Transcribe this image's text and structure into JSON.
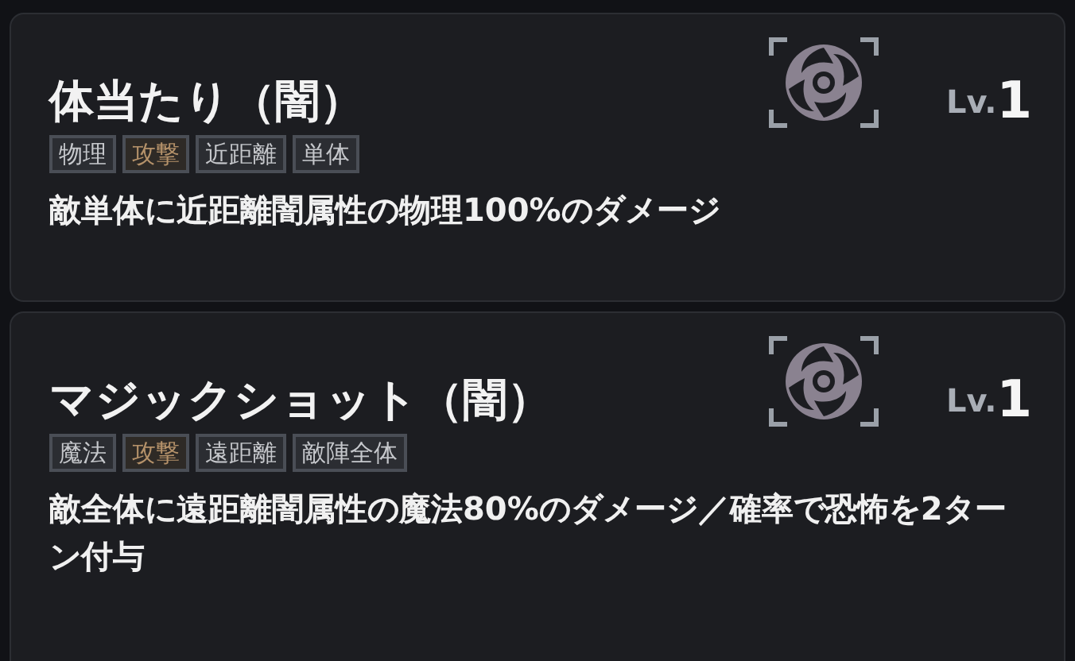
{
  "skills": [
    {
      "name": "体当たり（闇）",
      "level_label": "Lv.",
      "level_value": "1",
      "tags": [
        {
          "label": "物理",
          "kind": "plain"
        },
        {
          "label": "攻撃",
          "kind": "attack"
        },
        {
          "label": "近距離",
          "kind": "plain"
        },
        {
          "label": "単体",
          "kind": "plain"
        }
      ],
      "description": "敵単体に近距離闇属性の物理100%のダメージ"
    },
    {
      "name": "マジックショット（闇）",
      "level_label": "Lv.",
      "level_value": "1",
      "tags": [
        {
          "label": "魔法",
          "kind": "plain"
        },
        {
          "label": "攻撃",
          "kind": "attack"
        },
        {
          "label": "遠距離",
          "kind": "plain"
        },
        {
          "label": "敵陣全体",
          "kind": "plain"
        }
      ],
      "description": "敵全体に遠距離闇属性の魔法80%のダメージ／確率で恐怖を2ターン付与"
    }
  ]
}
